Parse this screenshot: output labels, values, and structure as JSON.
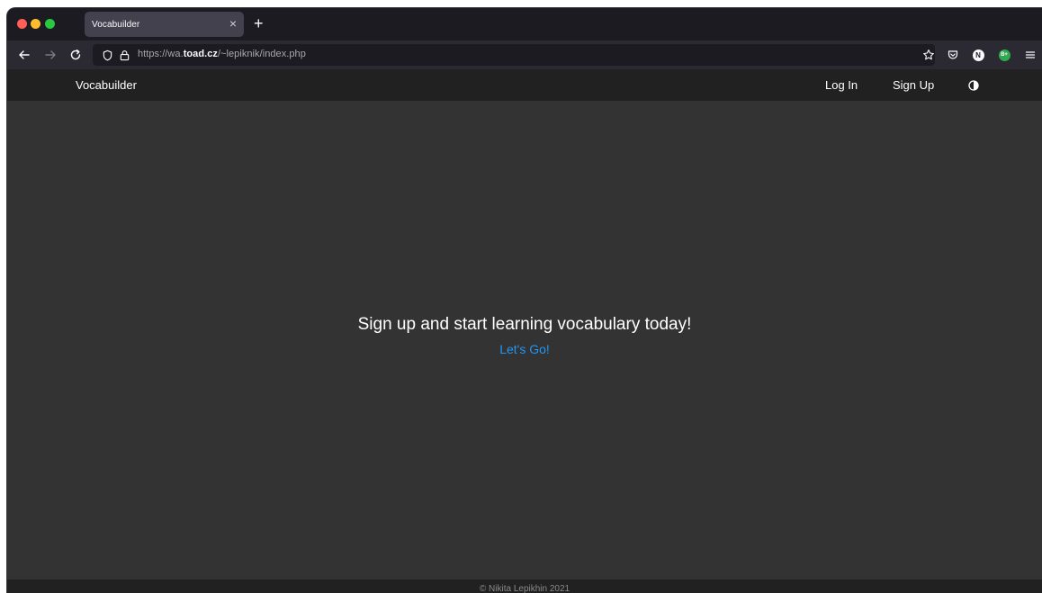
{
  "browser": {
    "tab": {
      "title": "Vocabuilder",
      "close_glyph": "×"
    },
    "new_tab_glyph": "+",
    "url": {
      "prefix": "https://wa.",
      "domain": "toad.cz",
      "path": "/~lepiknik/index.php"
    },
    "extensions": {
      "n_label": "N",
      "b_label": "B+"
    }
  },
  "site": {
    "brand": "Vocabuilder",
    "nav": {
      "login": "Log In",
      "signup": "Sign Up"
    },
    "hero": {
      "title": "Sign up and start learning vocabulary today!",
      "cta": "Let's Go!"
    },
    "footer": "© Nikita Lepikhin 2021"
  },
  "colors": {
    "page_bg": "#333333",
    "nav_bg": "#212121",
    "link": "#2196f3"
  }
}
